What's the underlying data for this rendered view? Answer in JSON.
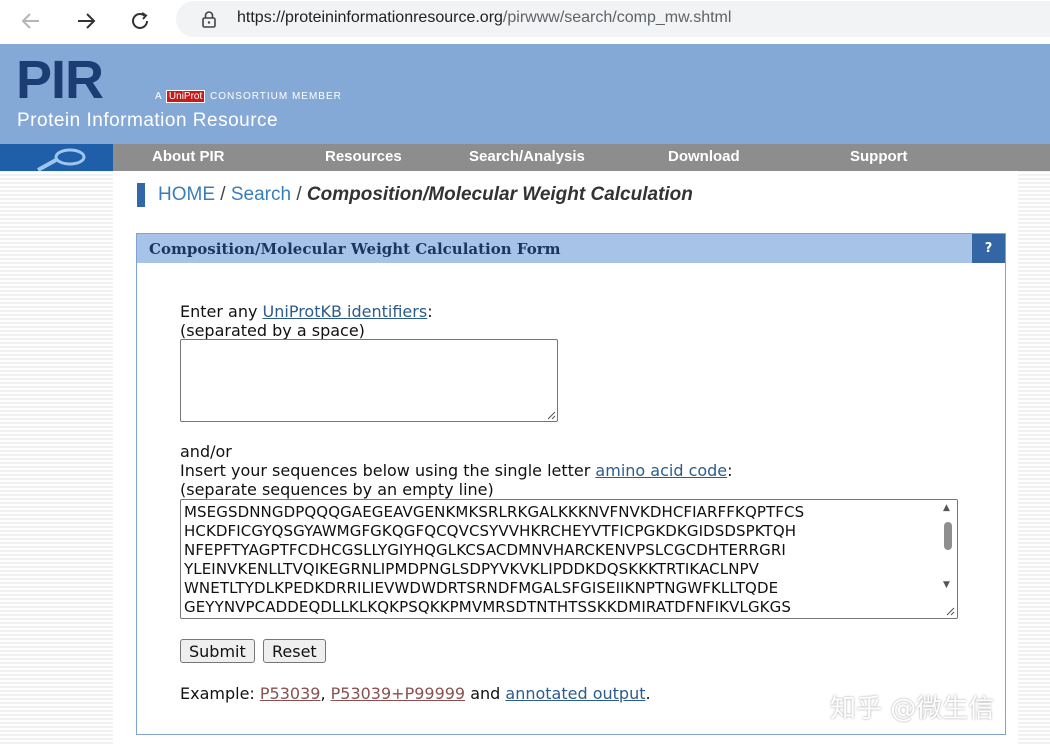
{
  "browser": {
    "url_host": "https://proteininformationresource.org",
    "url_path": "/pirwww/search/comp_mw.shtml",
    "back_icon": "arrow-left-icon",
    "forward_icon": "arrow-right-icon",
    "reload_icon": "reload-icon",
    "lock_icon": "lock-icon"
  },
  "header": {
    "logo": "PIR",
    "consortium_prefix": "A",
    "uniprot": "UniProt",
    "consortium_member": "CONSORTIUM MEMBER",
    "subtitle": "Protein Information Resource"
  },
  "menu": {
    "items": [
      "About PIR",
      "Resources",
      "Search/Analysis",
      "Download",
      "Support"
    ]
  },
  "breadcrumb": {
    "home": "HOME",
    "sep1": " / ",
    "search": "Search",
    "sep2": " / ",
    "current": "Composition/Molecular Weight Calculation"
  },
  "form": {
    "title": "Composition/Molecular Weight Calculation Form",
    "help": "?",
    "ids_label_prefix": "Enter any ",
    "ids_link": "UniProtKB identifiers",
    "ids_label_suffix": ":",
    "ids_hint": "(separated by a space)",
    "andor": "and/or",
    "seq_label_prefix": "Insert your sequences below using the single letter ",
    "seq_link": "amino acid code",
    "seq_label_suffix": ":",
    "seq_hint": "(separate sequences by an empty line)",
    "sequence_lines": [
      "MSEGSDNNGDPQQQGAEGEAVGENKMKSRLRKGALKKKNVFNVKDHCFIARFFKQPTFCS",
      "HCKDFICGYQSGYAWMGFGKQGFQCQVCSYVVHKRCHEYVTFICPGKDKGIDSDSPKTQH",
      "NFEPFTYAGPTFCDHCGSLLYGIYHQGLKCSACDMNVHARCKENVPSLCGCDHTERRGRI",
      "YLEINVKENLLTVQIKEGRNLIPMDPNGLSDPYVKVKLIPDDKDQSKKKTRTIKACLNPV",
      "WNETLTYDLKPEDKDRRILIEVWDWDRTSRNDFMGALSFGISEIIKNPTNGWFKLLTQDE",
      "GEYYNVPCADDEQDLLKLKQKPSQKKPMVMRSDTNTHTSSKKDMIRATDFNFIKVLGKGS"
    ],
    "submit": "Submit",
    "reset": "Reset",
    "example_label": "Example: ",
    "example1": "P53039",
    "comma": ", ",
    "example2": "P53039+P99999",
    "and": " and ",
    "example3": "annotated output",
    "period": "."
  },
  "watermark": "知乎 @微生信"
}
